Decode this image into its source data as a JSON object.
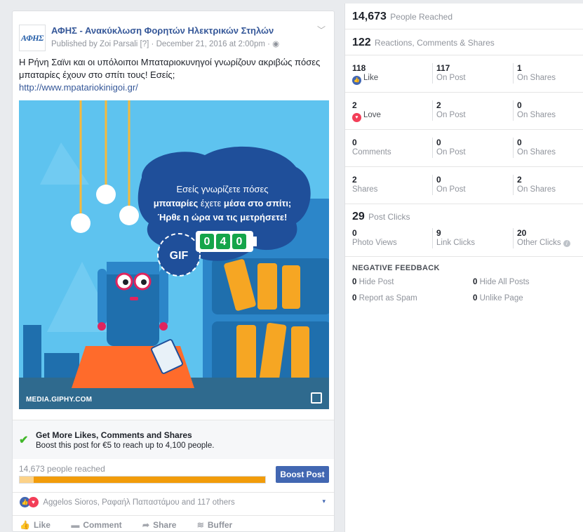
{
  "post": {
    "page_name": "ΑΦΗΣ - Ανακύκλωση Φορητών Ηλεκτρικών Στηλών",
    "logo_text": "ΑΦΗΣ",
    "meta": "Published by Zoi Parsali [?] · December 21, 2016 at 2:00pm · ",
    "text": "Η Ρήνη Σαϊνι και οι υπόλοιποι Μπαταριοκυνηγοί γνωρίζουν ακριβώς πόσες μπαταρίες έχουν στο σπίτι τους! Εσείς;",
    "link": "http://www.mpatariokinigoi.gr/",
    "media": {
      "bubble_line1": "Εσείς γνωρίζετε πόσες",
      "bubble_line2a": "μπαταρίες",
      "bubble_line2b": " έχετε ",
      "bubble_line2c": "μέσα στο σπίτι;",
      "bubble_line3": "Ήρθε η ώρα να τις μετρήσετε!",
      "counter": [
        "0",
        "4",
        "0"
      ],
      "gif_label": "GIF",
      "caption": "MEDIA.GIPHY.COM"
    },
    "promo": {
      "title": "Get More Likes, Comments and Shares",
      "subtitle": "Boost this post for €5 to reach up to 4,100 people."
    },
    "reach": {
      "label": "14,673 people reached",
      "boost_label": "Boost Post",
      "progress_fraction": 1.0
    },
    "reactions": {
      "text": "Aggelos Sioros, Ραφαήλ Παπαστάμου and 117 others"
    },
    "actions": [
      {
        "label": "Like",
        "icon": "thumb-icon"
      },
      {
        "label": "Comment",
        "icon": "comment-icon"
      },
      {
        "label": "Share",
        "icon": "share-icon"
      },
      {
        "label": "Buffer",
        "icon": "buffer-icon"
      }
    ]
  },
  "insights": {
    "reached_num": "14,673",
    "reached_lbl": "People Reached",
    "rcs_num": "122",
    "rcs_lbl": "Reactions, Comments & Shares",
    "rows": [
      {
        "name": "like",
        "c1_num": "118",
        "c1_lbl": "Like",
        "c2_num": "117",
        "c2_lbl": "On Post",
        "c3_num": "1",
        "c3_lbl": "On Shares"
      },
      {
        "name": "love",
        "c1_num": "2",
        "c1_lbl": "Love",
        "c2_num": "2",
        "c2_lbl": "On Post",
        "c3_num": "0",
        "c3_lbl": "On Shares"
      },
      {
        "name": "comments",
        "c1_num": "0",
        "c1_lbl": "Comments",
        "c2_num": "0",
        "c2_lbl": "On Post",
        "c3_num": "0",
        "c3_lbl": "On Shares"
      },
      {
        "name": "shares",
        "c1_num": "2",
        "c1_lbl": "Shares",
        "c2_num": "0",
        "c2_lbl": "On Post",
        "c3_num": "2",
        "c3_lbl": "On Shares"
      }
    ],
    "clicks_num": "29",
    "clicks_lbl": "Post Clicks",
    "clicks": {
      "c1_num": "0",
      "c1_lbl": "Photo Views",
      "c2_num": "9",
      "c2_lbl": "Link Clicks",
      "c3_num": "20",
      "c3_lbl": "Other Clicks"
    },
    "negative": {
      "title": "NEGATIVE FEEDBACK",
      "hide_post_num": "0",
      "hide_post_lbl": "Hide Post",
      "hide_all_num": "0",
      "hide_all_lbl": "Hide All Posts",
      "spam_num": "0",
      "spam_lbl": "Report as Spam",
      "unlike_num": "0",
      "unlike_lbl": "Unlike Page"
    }
  },
  "colors": {
    "brand": "#4267b2",
    "link": "#365899",
    "reach_bar": "#f29c0a",
    "love": "#f33e58",
    "check": "#42b72a"
  }
}
